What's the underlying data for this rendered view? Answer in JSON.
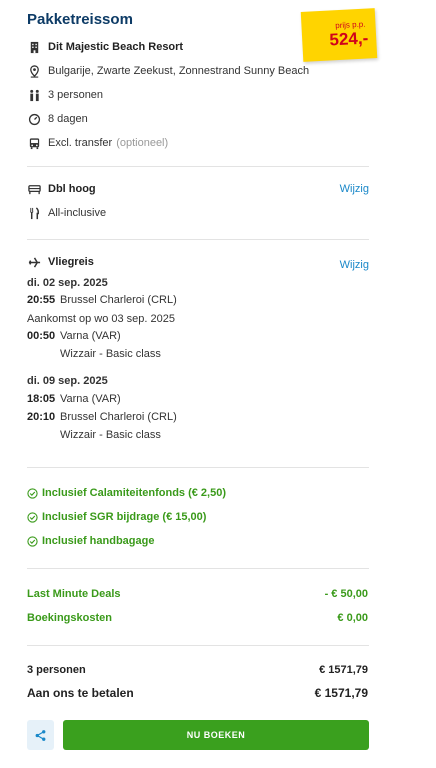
{
  "header": {
    "title": "Pakketreissom",
    "price_label": "prijs p.p.",
    "price_value": "524,-"
  },
  "summary": {
    "hotel": "Dit Majestic Beach Resort",
    "location": "Bulgarije, Zwarte Zeekust, Zonnestrand Sunny Beach",
    "persons": "3 personen",
    "duration": "8 dagen",
    "transfer": "Excl. transfer",
    "transfer_note": "(optioneel)"
  },
  "room": {
    "type": "Dbl hoog",
    "board": "All-inclusive",
    "change_label": "Wijzig"
  },
  "flight": {
    "title": "Vliegreis",
    "change_label": "Wijzig",
    "outbound": {
      "date": "di. 02 sep. 2025",
      "dep_time": "20:55",
      "dep_airport": "Brussel Charleroi (CRL)",
      "arrival_note": "Aankomst op wo 03 sep. 2025",
      "arr_time": "00:50",
      "arr_airport": "Varna (VAR)",
      "carrier": "Wizzair - Basic class"
    },
    "inbound": {
      "date": "di. 09 sep. 2025",
      "dep_time": "18:05",
      "dep_airport": "Varna (VAR)",
      "arr_time": "20:10",
      "arr_airport": "Brussel Charleroi (CRL)",
      "carrier": "Wizzair - Basic class"
    }
  },
  "inclusions": [
    "Inclusief Calamiteitenfonds (€ 2,50)",
    "Inclusief SGR bijdrage (€ 15,00)",
    "Inclusief handbagage"
  ],
  "fees": {
    "deal_label": "Last Minute Deals",
    "deal_value": "- € 50,00",
    "booking_label": "Boekingskosten",
    "booking_value": "€ 0,00"
  },
  "totals": {
    "persons_label": "3 personen",
    "persons_value": "€ 1571,79",
    "pay_label": "Aan ons te betalen",
    "pay_value": "€ 1571,79"
  },
  "actions": {
    "book_label": "NU BOEKEN"
  },
  "colors": {
    "title": "#0d3b66",
    "link": "#1a88c9",
    "green": "#3aa01e",
    "price_tag": "#ffd400",
    "price_text": "#d0021b"
  }
}
